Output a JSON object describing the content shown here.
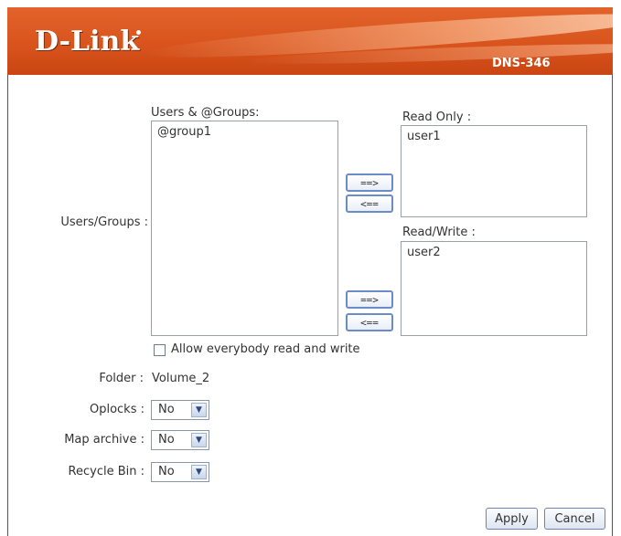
{
  "header": {
    "brand": "D-Link",
    "model": "DNS-346"
  },
  "colors": {
    "header_orange": "#d9541d",
    "button_border": "#6a8cc8"
  },
  "labels": {
    "users_groups_list": "Users & @Groups:",
    "read_only": "Read Only :",
    "read_write": "Read/Write :",
    "users_groups": "Users/Groups :",
    "folder": "Folder :",
    "oplocks": "Oplocks :",
    "map_archive": "Map archive :",
    "recycle_bin": "Recycle Bin :"
  },
  "lists": {
    "users_groups": [
      "@group1"
    ],
    "read_only": [
      "user1"
    ],
    "read_write": [
      "user2"
    ]
  },
  "arrows": {
    "add": "==>",
    "remove": "<=="
  },
  "allow_everybody": {
    "label": "Allow everybody read and write",
    "checked": false
  },
  "folder_value": "Volume_2",
  "selects": {
    "oplocks": "No",
    "map_archive": "No",
    "recycle_bin": "No"
  },
  "icons": {
    "dropdown": "chevron-down-icon"
  },
  "buttons": {
    "apply": "Apply",
    "cancel": "Cancel"
  }
}
